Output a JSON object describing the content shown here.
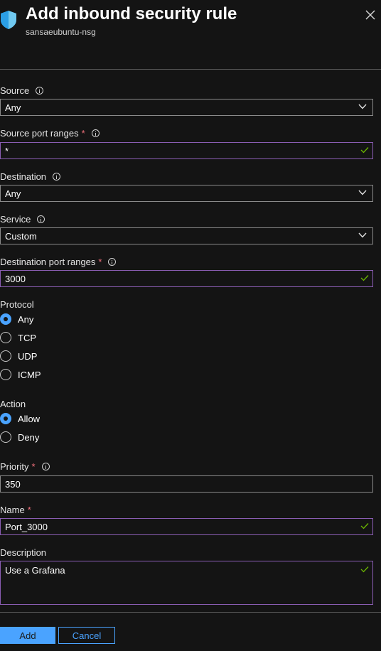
{
  "header": {
    "title": "Add inbound security rule",
    "subtitle": "sansaeubuntu-nsg",
    "icon": "shield-icon",
    "close_icon": "close-icon"
  },
  "fields": {
    "source": {
      "label": "Source",
      "value": "Any"
    },
    "source_port_ranges": {
      "label": "Source port ranges",
      "required_mark": "*",
      "value": "*"
    },
    "destination": {
      "label": "Destination",
      "value": "Any"
    },
    "service": {
      "label": "Service",
      "value": "Custom"
    },
    "destination_port_ranges": {
      "label": "Destination port ranges",
      "required_mark": "*",
      "value": "3000"
    },
    "protocol": {
      "label": "Protocol",
      "options": [
        "Any",
        "TCP",
        "UDP",
        "ICMP"
      ],
      "selected": "Any"
    },
    "action": {
      "label": "Action",
      "options": [
        "Allow",
        "Deny"
      ],
      "selected": "Allow"
    },
    "priority": {
      "label": "Priority",
      "required_mark": "*",
      "value": "350"
    },
    "name": {
      "label": "Name",
      "required_mark": "*",
      "value": "Port_3000"
    },
    "description": {
      "label": "Description",
      "value": "Use a Grafana"
    }
  },
  "footer": {
    "add_label": "Add",
    "cancel_label": "Cancel"
  },
  "colors": {
    "background": "#141414",
    "accent": "#4aa3ff",
    "valid_border": "#8a5db3",
    "valid_check": "#6bb700",
    "required": "#f1707b",
    "shield_light": "#7fd3f5",
    "shield_dark": "#1d8fd6"
  }
}
